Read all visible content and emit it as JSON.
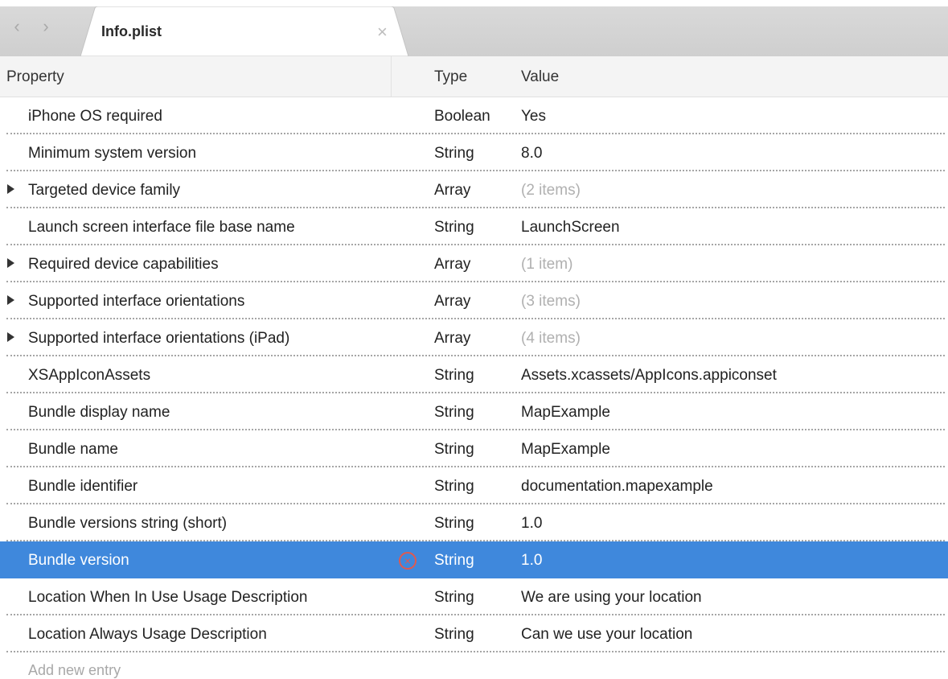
{
  "tab": {
    "title": "Info.plist",
    "back_glyph": "‹",
    "forward_glyph": "›",
    "close_glyph": "×"
  },
  "columns": {
    "property": "Property",
    "type": "Type",
    "value": "Value"
  },
  "rows": [
    {
      "property": "iPhone OS required",
      "type": "Boolean",
      "value": "Yes",
      "expandable": false,
      "muted": false
    },
    {
      "property": "Minimum system version",
      "type": "String",
      "value": "8.0",
      "expandable": false,
      "muted": false
    },
    {
      "property": "Targeted device family",
      "type": "Array",
      "value": "(2 items)",
      "expandable": true,
      "muted": true
    },
    {
      "property": "Launch screen interface file base name",
      "type": "String",
      "value": "LaunchScreen",
      "expandable": false,
      "muted": false
    },
    {
      "property": "Required device capabilities",
      "type": "Array",
      "value": "(1 item)",
      "expandable": true,
      "muted": true
    },
    {
      "property": "Supported interface orientations",
      "type": "Array",
      "value": "(3 items)",
      "expandable": true,
      "muted": true
    },
    {
      "property": "Supported interface orientations (iPad)",
      "type": "Array",
      "value": "(4 items)",
      "expandable": true,
      "muted": true
    },
    {
      "property": "XSAppIconAssets",
      "type": "String",
      "value": "Assets.xcassets/AppIcons.appiconset",
      "expandable": false,
      "muted": false
    },
    {
      "property": "Bundle display name",
      "type": "String",
      "value": "MapExample",
      "expandable": false,
      "muted": false
    },
    {
      "property": "Bundle name",
      "type": "String",
      "value": "MapExample",
      "expandable": false,
      "muted": false
    },
    {
      "property": "Bundle identifier",
      "type": "String",
      "value": "documentation.mapexample",
      "expandable": false,
      "muted": false
    },
    {
      "property": "Bundle versions string (short)",
      "type": "String",
      "value": "1.0",
      "expandable": false,
      "muted": false
    },
    {
      "property": "Bundle version",
      "type": "String",
      "value": "1.0",
      "expandable": false,
      "muted": false,
      "selected": true
    },
    {
      "property": "Location When In Use Usage Description",
      "type": "String",
      "value": "We are using your location",
      "expandable": false,
      "muted": false
    },
    {
      "property": "Location Always Usage Description",
      "type": "String",
      "value": "Can we use your location",
      "expandable": false,
      "muted": false
    }
  ],
  "add_entry": "Add new entry",
  "remove_glyph": "×",
  "colors": {
    "selection": "#3f88dc",
    "remove": "#e0594f",
    "muted_text": "#b0b0b0"
  }
}
